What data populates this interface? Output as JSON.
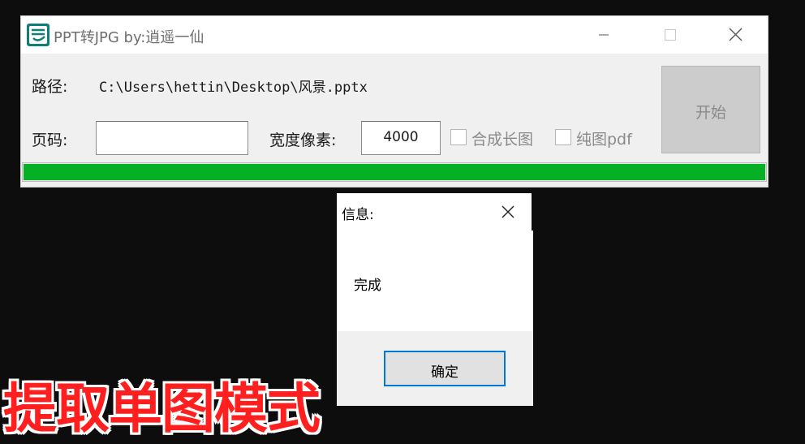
{
  "window": {
    "title": "PPT转JPG  by:逍遥一仙"
  },
  "form": {
    "path_label": "路径:",
    "path_value": "C:\\Users\\hettin\\Desktop\\风景.pptx",
    "page_label": "页码:",
    "page_value": "",
    "width_label": "宽度像素:",
    "width_value": "4000",
    "merge_long_label": "合成长图",
    "merge_long_checked": false,
    "pure_pdf_label": "纯图pdf",
    "pure_pdf_checked": false,
    "start_label": "开始",
    "progress": 1.0,
    "progress_color": "#06b025"
  },
  "dialog": {
    "title": "信息:",
    "message": "完成",
    "ok_label": "确定"
  },
  "caption": {
    "text": "提取单图模式",
    "color": "#ff1f1f"
  },
  "icons": [
    "app-icon",
    "minimize-icon",
    "maximize-icon",
    "close-icon",
    "dialog-close-icon"
  ]
}
